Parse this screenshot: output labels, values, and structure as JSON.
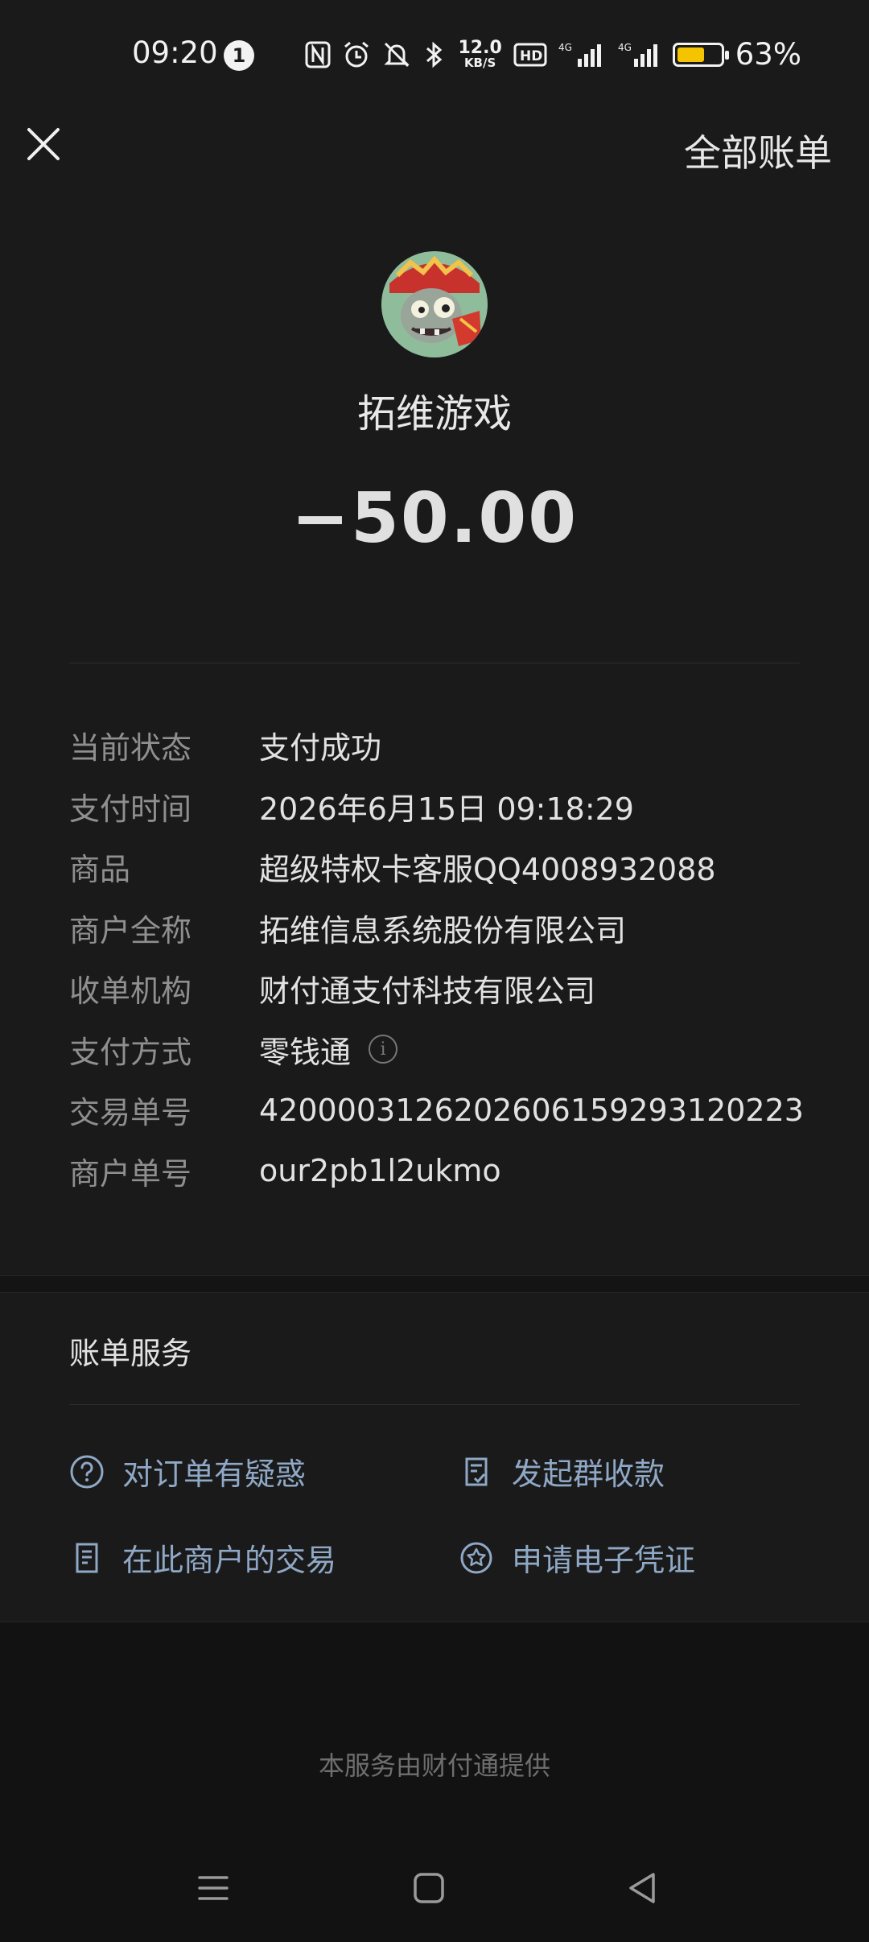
{
  "status_bar": {
    "time": "09:20",
    "notification_count": "1",
    "net_speed_value": "12.0",
    "net_speed_unit": "KB/S",
    "battery_percent": "63%",
    "battery_level": 0.63,
    "battery_color": "#f5c400"
  },
  "header": {
    "close_icon": "close-icon",
    "all_bills_label": "全部账单"
  },
  "merchant": {
    "name": "拓维游戏",
    "amount": "−50.00"
  },
  "details": [
    {
      "label": "当前状态",
      "value": "支付成功"
    },
    {
      "label": "支付时间",
      "value": "2026年6月15日 09:18:29"
    },
    {
      "label": "商品",
      "value": "超级特权卡客服QQ4008932088"
    },
    {
      "label": "商户全称",
      "value": "拓维信息系统股份有限公司"
    },
    {
      "label": "收单机构",
      "value": "财付通支付科技有限公司"
    },
    {
      "label": "支付方式",
      "value": "零钱通"
    },
    {
      "label": "交易单号",
      "value": "4200003126202606159293120223"
    },
    {
      "label": "商户单号",
      "value": "our2pb1l2ukmo"
    }
  ],
  "services": {
    "title": "账单服务",
    "items": [
      {
        "label": "对订单有疑惑",
        "icon": "question-circle-icon"
      },
      {
        "label": "发起群收款",
        "icon": "group-collect-icon"
      },
      {
        "label": "在此商户的交易",
        "icon": "receipt-icon"
      },
      {
        "label": "申请电子凭证",
        "icon": "certificate-icon"
      }
    ]
  },
  "footer": {
    "note": "本服务由财付通提供"
  },
  "colors": {
    "background": "#1a1a1a",
    "service_link": "#8fa8c6",
    "label_gray": "#8f8f8f"
  }
}
